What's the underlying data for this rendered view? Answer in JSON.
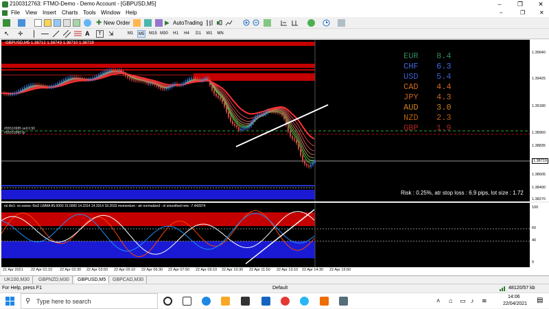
{
  "window": {
    "title": "2100312763: FTMO-Demo - Demo Account - [GBPUSD,M5]"
  },
  "menu": [
    "File",
    "View",
    "Insert",
    "Charts",
    "Tools",
    "Window",
    "Help"
  ],
  "toolbar": {
    "new_order": "New Order",
    "autotrading": "AutoTrading"
  },
  "timeframes": [
    "M1",
    "M5",
    "M15",
    "M30",
    "H1",
    "H4",
    "D1",
    "W1",
    "MN"
  ],
  "chart": {
    "symbol_header": "GBPUSD,M5  1.38712 1.38743 1.38710 1.38719",
    "hline_labels": [
      "#55510985 sell 0.50",
      "#55510985 tp"
    ],
    "risk_text": "Risk : 0.25%, atr stop loss : 6.9 pips, lot size : 1.72",
    "price_labels": [
      "1.39640",
      "1.39425",
      "1.39180",
      "1.38960",
      "1.38835",
      "1.38719",
      "1.38605",
      "1.38490",
      "1.38270"
    ],
    "current_price": "1.38719",
    "strength": [
      {
        "currency": "EUR",
        "value": "8.4",
        "color": "#2e8b57"
      },
      {
        "currency": "CHF",
        "value": "6.3",
        "color": "#4169e1"
      },
      {
        "currency": "USD",
        "value": "5.4",
        "color": "#3a5fcd"
      },
      {
        "currency": "CAD",
        "value": "4.4",
        "color": "#d2691e"
      },
      {
        "currency": "JPY",
        "value": "4.3",
        "color": "#c8641e"
      },
      {
        "currency": "AUD",
        "value": "3.0",
        "color": "#cd8020"
      },
      {
        "currency": "NZD",
        "value": "2.3",
        "color": "#b8600a"
      },
      {
        "currency": "GBP",
        "value": "1.9",
        "color": "#b22222"
      }
    ]
  },
  "rsi": {
    "header": "rsi div1: rsi zones: Rsi2 LWMA 85.0000 15.0000 14.3314 14.3314 18.2033  momentum - atr normalized - nl smoothed nmc -7.442874",
    "levels": [
      "100",
      "60",
      "40",
      "0"
    ]
  },
  "time_labels": [
    "21 Apr 2021",
    "22 Apr 01:10",
    "22 Apr 02:30",
    "22 Apr 03:50",
    "22 Apr 05:10",
    "22 Apr 06:30",
    "22 Apr 07:50",
    "22 Apr 09:10",
    "22 Apr 10:30",
    "22 Apr 11:50",
    "22 Apr 13:10",
    "22 Apr 14:30",
    "22 Apr 15:50"
  ],
  "tabs": [
    "UK100,M30",
    "GBPNZD,M30",
    "GBPUSD,M5",
    "GBPCAD,M30"
  ],
  "active_tab": "GBPUSD,M5",
  "status": {
    "help": "For Help, press F1",
    "profile": "Default",
    "traffic": "48120/57 kb"
  },
  "taskbar": {
    "search_placeholder": "Type here to search",
    "time": "14:06",
    "date": "22/04/2021"
  }
}
